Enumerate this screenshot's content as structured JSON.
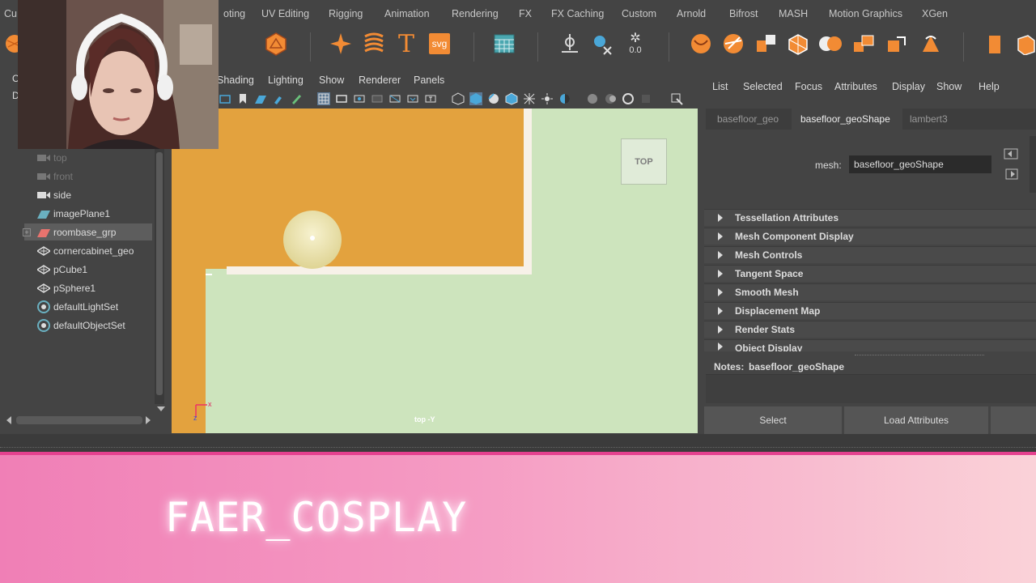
{
  "shelf_tabs": [
    "Cu",
    "oting",
    "UV Editing",
    "Rigging",
    "Animation",
    "Rendering",
    "FX",
    "FX Caching",
    "Custom",
    "Arnold",
    "Bifrost",
    "MASH",
    "Motion Graphics",
    "XGen"
  ],
  "shelf_icons": {
    "svg_label": "svg",
    "coord_label": "0.0",
    "text_label": "T"
  },
  "outliner": {
    "left_labels": [
      "C",
      "D"
    ],
    "items": [
      {
        "label": "top",
        "icon": "camera-icon",
        "dim": true
      },
      {
        "label": "front",
        "icon": "camera-icon",
        "dim": true
      },
      {
        "label": "side",
        "icon": "camera-icon"
      },
      {
        "label": "imagePlane1",
        "icon": "image-plane-icon"
      },
      {
        "label": "roombase_grp",
        "icon": "group-icon",
        "selected": true
      },
      {
        "label": "cornercabinet_geo",
        "icon": "mesh-icon"
      },
      {
        "label": "pCube1",
        "icon": "mesh-icon"
      },
      {
        "label": "pSphere1",
        "icon": "mesh-icon"
      },
      {
        "label": "defaultLightSet",
        "icon": "set-icon"
      },
      {
        "label": "defaultObjectSet",
        "icon": "set-icon"
      }
    ]
  },
  "viewport": {
    "menus": [
      "Shading",
      "Lighting",
      "Show",
      "Renderer",
      "Panels"
    ],
    "view_cube": "TOP",
    "camera_label": "top -Y",
    "axis_x": "x",
    "axis_z": "z"
  },
  "attr_editor": {
    "menus": [
      "List",
      "Selected",
      "Focus",
      "Attributes",
      "Display",
      "Show",
      "Help"
    ],
    "tabs": [
      "basefloor_geo",
      "basefloor_geoShape",
      "lambert3"
    ],
    "mesh_label": "mesh:",
    "mesh_value": "basefloor_geoShape",
    "sections": [
      "Tessellation Attributes",
      "Mesh Component Display",
      "Mesh Controls",
      "Tangent Space",
      "Smooth Mesh",
      "Displacement Map",
      "Render Stats",
      "Object Display"
    ],
    "notes_label": "Notes:",
    "notes_value": "basefloor_geoShape",
    "select_label": "Select",
    "load_label": "Load Attributes"
  },
  "banner": {
    "streamer_name": "FAER_COSPLAY"
  },
  "colors": {
    "accent": "#e5418f",
    "viewport_bg": "#cde4bd",
    "floor_orange": "#e3a23e",
    "maya_gray": "#444444"
  }
}
